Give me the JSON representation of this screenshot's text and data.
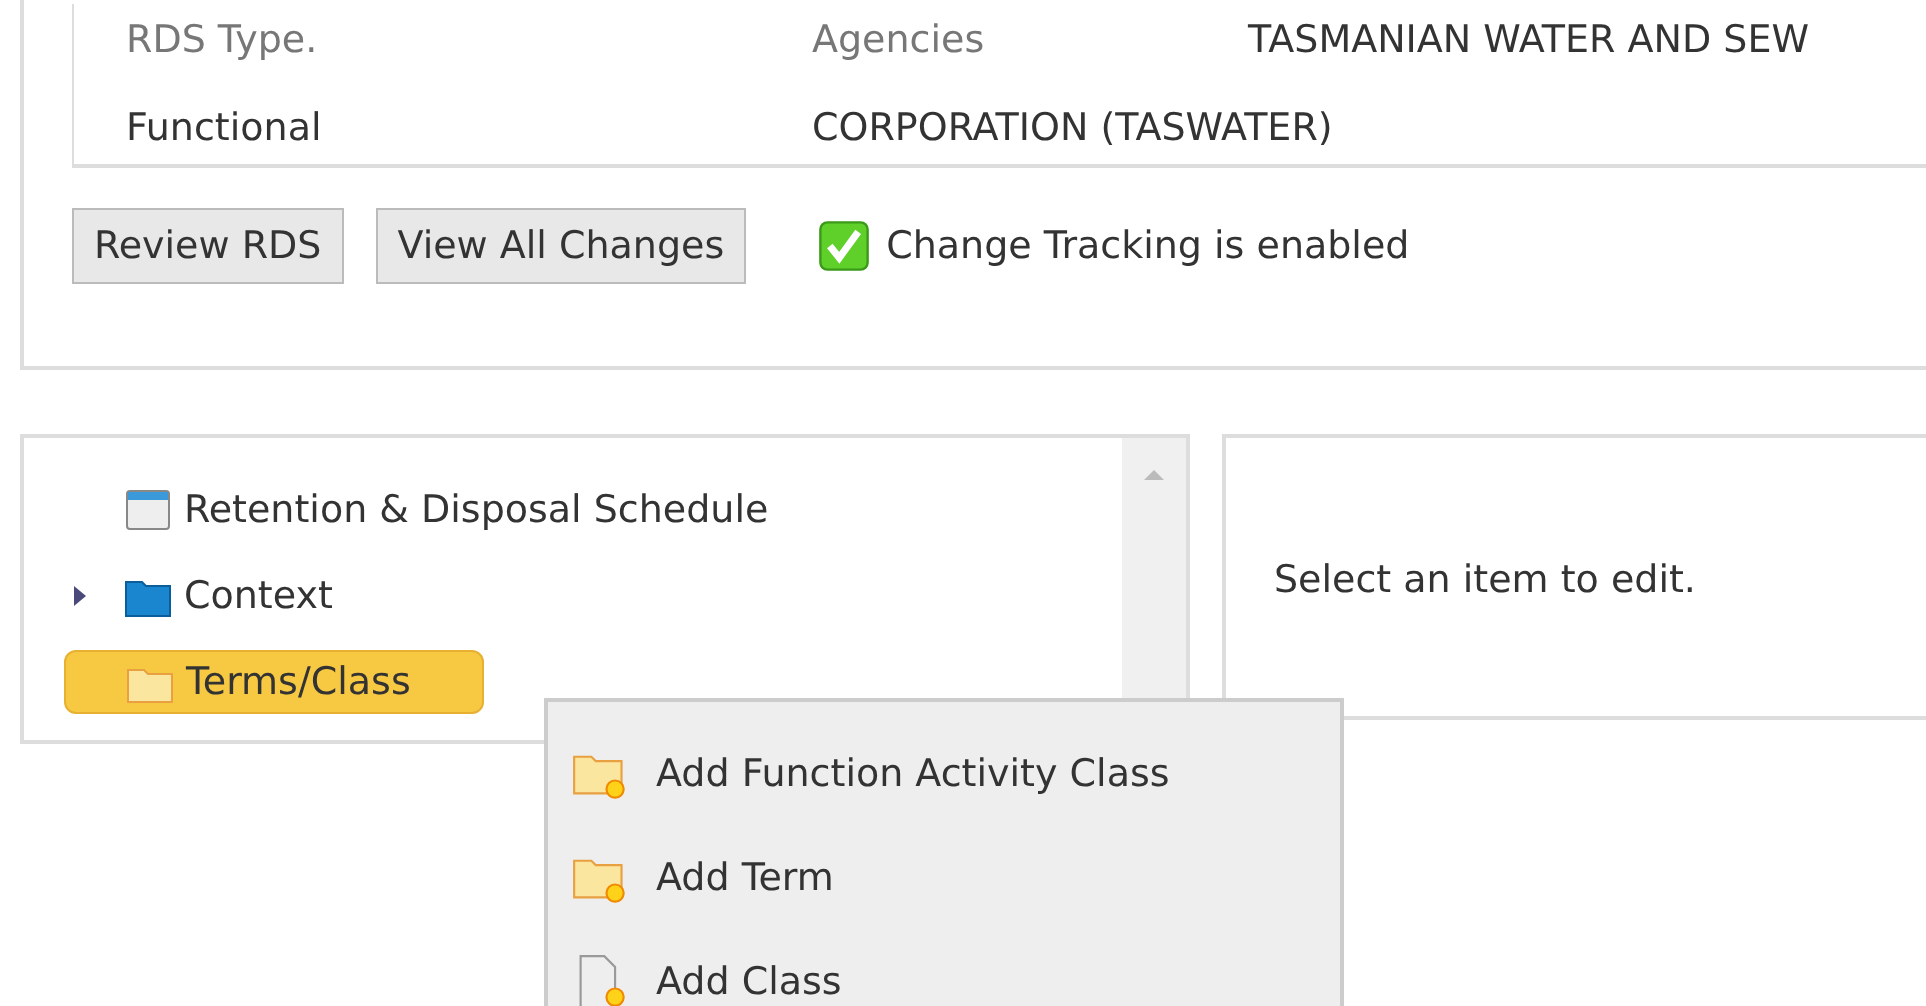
{
  "details": {
    "rows": [
      [
        "RDS Type.",
        "Agencies",
        "TASMANIAN WATER AND SEW"
      ],
      [
        "Functional",
        "CORPORATION (TASWATER)",
        ""
      ]
    ]
  },
  "buttons": [
    "Review RDS",
    "View All Changes"
  ],
  "tracking": {
    "checked": true,
    "label": "Change Tracking is enabled"
  },
  "tree": {
    "items": [
      {
        "label": "Retention & Disposal Schedule",
        "kind": "schedule",
        "selected": false
      },
      {
        "label": "Context",
        "kind": "folder",
        "expanded": false,
        "selected": false
      },
      {
        "label": "Terms/Class",
        "kind": "open-folder",
        "selected": true
      }
    ]
  },
  "editor": {
    "message": "Select an item to edit."
  },
  "context_menu": {
    "items": [
      {
        "label": "Add Function Activity Class",
        "kind": "folder"
      },
      {
        "label": "Add Term",
        "kind": "folder"
      },
      {
        "label": "Add Class",
        "kind": "document"
      }
    ]
  }
}
